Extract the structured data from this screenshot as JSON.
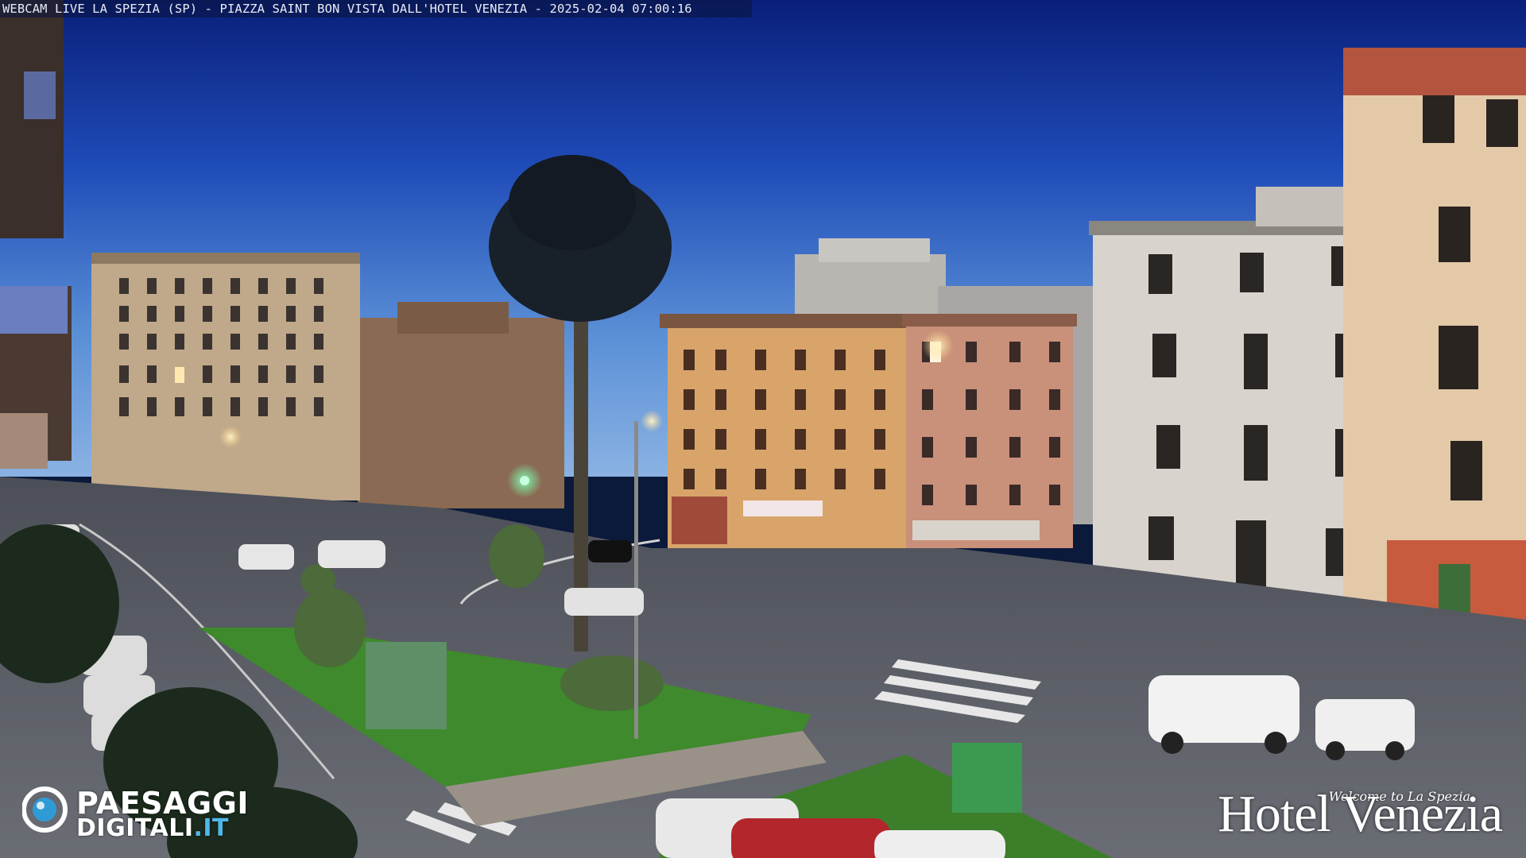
{
  "overlay": {
    "caption": "WEBCAM LIVE LA SPEZIA (SP) - PIAZZA SAINT BON VISTA DALL'HOTEL VENEZIA - 2025-02-04 07:00:16"
  },
  "watermark_left": {
    "line1": "PAESAGGI",
    "line2_main": "DIGITALI",
    "line2_tld": ".IT"
  },
  "watermark_right": {
    "welcome": "Welcome to La Spezia",
    "name": "Hotel Venezia"
  },
  "colors": {
    "sky_top": "#0a1f7a",
    "sky_horizon": "#6fa2dd",
    "grass": "#3e8a2c",
    "road": "#5a5d66",
    "traffic_light": "#38e07a"
  }
}
